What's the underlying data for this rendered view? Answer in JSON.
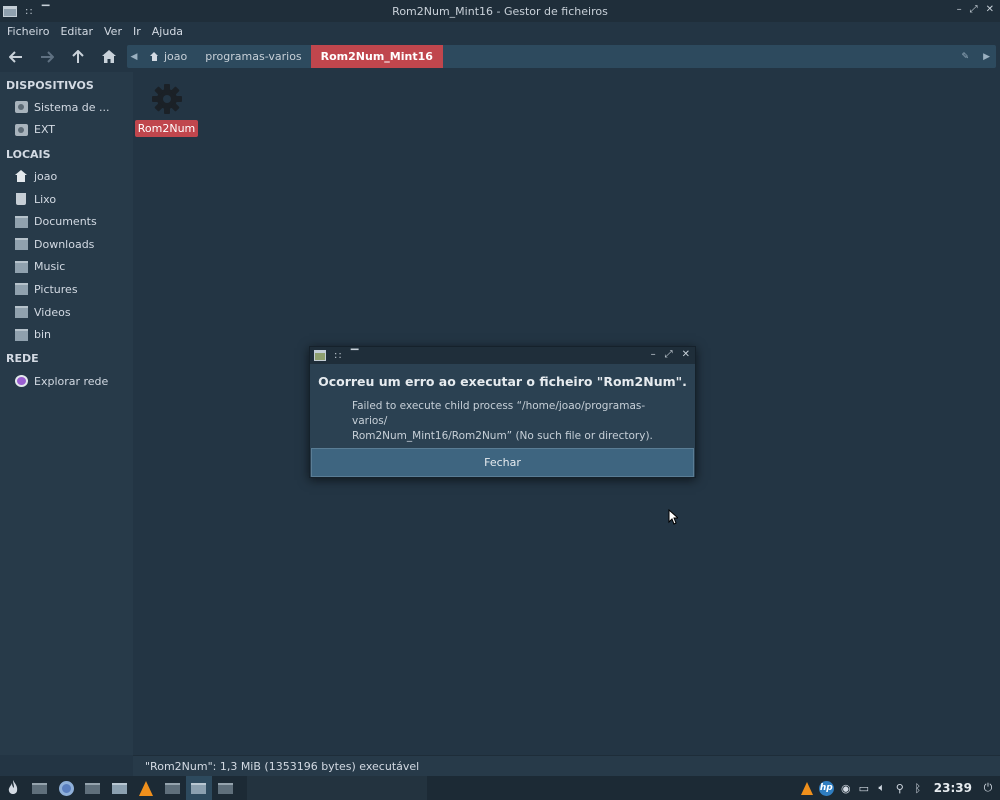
{
  "window": {
    "title": "Rom2Num_Mint16 - Gestor de ficheiros",
    "controls": [
      "minimize",
      "maximize",
      "close"
    ]
  },
  "menubar": {
    "items": [
      "Ficheiro",
      "Editar",
      "Ver",
      "Ir",
      "Ajuda"
    ]
  },
  "toolbar": {
    "back_icon": "arrow-left-icon",
    "forward_icon": "arrow-right-icon",
    "up_icon": "arrow-up-icon",
    "home_icon": "home-icon"
  },
  "pathbar": {
    "crumbs": [
      {
        "label": "joao",
        "icon": "home-icon"
      },
      {
        "label": "programas-varios"
      },
      {
        "label": "Rom2Num_Mint16",
        "active": true
      }
    ]
  },
  "sidebar": {
    "sections": [
      {
        "heading": "DISPOSITIVOS",
        "items": [
          {
            "label": "Sistema de ...",
            "icon": "drive-icon"
          },
          {
            "label": "EXT",
            "icon": "drive-icon"
          }
        ]
      },
      {
        "heading": "LOCAIS",
        "items": [
          {
            "label": "joao",
            "icon": "home-icon"
          },
          {
            "label": "Lixo",
            "icon": "trash-icon"
          },
          {
            "label": "Documents",
            "icon": "folder-icon"
          },
          {
            "label": "Downloads",
            "icon": "folder-icon"
          },
          {
            "label": "Music",
            "icon": "folder-icon"
          },
          {
            "label": "Pictures",
            "icon": "folder-icon"
          },
          {
            "label": "Videos",
            "icon": "folder-icon"
          },
          {
            "label": "bin",
            "icon": "folder-icon"
          }
        ]
      },
      {
        "heading": "REDE",
        "items": [
          {
            "label": "Explorar rede",
            "icon": "network-icon"
          }
        ]
      }
    ]
  },
  "content": {
    "files": [
      {
        "name": "Rom2Num",
        "icon": "gear-icon",
        "selected": true
      }
    ]
  },
  "statusbar": {
    "text": "\"Rom2Num\": 1,3 MiB (1353196 bytes) executável"
  },
  "dialog": {
    "heading": "Ocorreu um erro ao executar o ficheiro \"Rom2Num\".",
    "body": "Failed to execute child process “/home/joao/programas-varios/Rom2Num_Mint16/Rom2Num” (No such file or directory).",
    "body_line1": "Failed to execute child process “/home/joao/programas-varios/",
    "body_line2": "Rom2Num_Mint16/Rom2Num” (No such file or directory).",
    "button": "Fechar"
  },
  "taskbar": {
    "tasks": [
      "menu-icon",
      "terminal-icon",
      "chrome-icon",
      "terminal-icon",
      "file-manager-icon",
      "vlc-icon",
      "terminal-icon",
      "file-manager-icon",
      "terminal-icon"
    ],
    "tray": [
      "vlc-icon",
      "hp-icon",
      "network-icon",
      "display-icon",
      "volume-icon",
      "clip-icon",
      "bluetooth-icon"
    ],
    "clock": "23:39"
  },
  "colors": {
    "accent": "#c0464d",
    "background": "#233544",
    "sidebar": "#273a49",
    "button": "#3e6580"
  }
}
